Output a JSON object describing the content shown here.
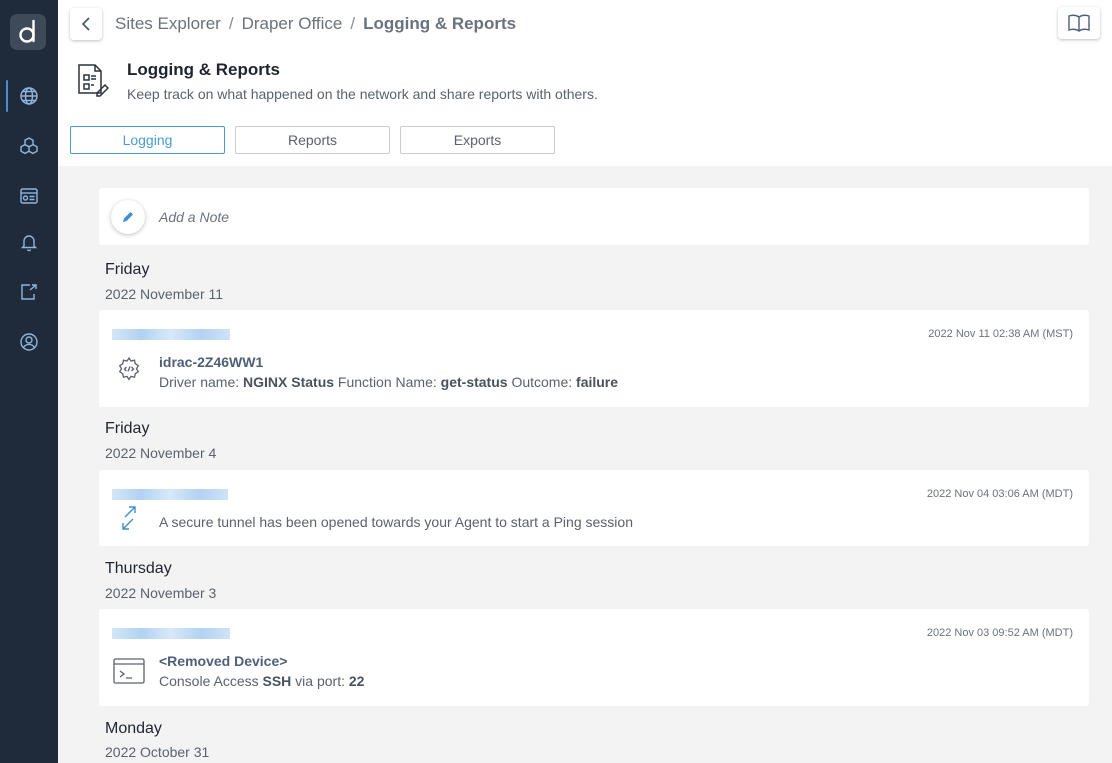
{
  "app": {
    "logo_letter": "d"
  },
  "sidebar": {
    "items": [
      {
        "icon": "globe-icon",
        "active": true
      },
      {
        "icon": "cubes-icon",
        "active": false
      },
      {
        "icon": "dashboard-icon",
        "active": false
      },
      {
        "icon": "bell-icon",
        "active": false
      },
      {
        "icon": "export-icon",
        "active": false
      },
      {
        "icon": "user-circle-icon",
        "active": false
      }
    ]
  },
  "breadcrumb": {
    "items": [
      "Sites Explorer",
      "Draper Office",
      "Logging & Reports"
    ],
    "separator": "/"
  },
  "page": {
    "title": "Logging & Reports",
    "subtitle": "Keep track on what happened on the network and share reports with others."
  },
  "tabs": [
    {
      "label": "Logging",
      "active": true
    },
    {
      "label": "Reports",
      "active": false
    },
    {
      "label": "Exports",
      "active": false
    }
  ],
  "note": {
    "label": "Add a Note"
  },
  "groups": [
    {
      "day": "Friday",
      "date": "2022 November 11",
      "entry": {
        "timestamp": "2022 Nov 11 02:38 AM (MST)",
        "icon": "gear-code-icon",
        "title": "idrac-2Z46WW1",
        "parts": [
          {
            "text": "Driver name: ",
            "bold": false
          },
          {
            "text": "NGINX Status",
            "bold": true
          },
          {
            "text": " Function Name: ",
            "bold": false
          },
          {
            "text": "get-status",
            "bold": true
          },
          {
            "text": " Outcome: ",
            "bold": false
          },
          {
            "text": "failure",
            "bold": true
          }
        ]
      }
    },
    {
      "day": "Friday",
      "date": "2022 November 4",
      "entry": {
        "timestamp": "2022 Nov 04 03:06 AM (MDT)",
        "icon": "tunnel-arrows-icon",
        "message": "A secure tunnel has been opened towards your Agent to start a Ping session"
      }
    },
    {
      "day": "Thursday",
      "date": "2022 November 3",
      "entry": {
        "timestamp": "2022 Nov 03 09:52 AM (MDT)",
        "icon": "terminal-icon",
        "title": "<Removed Device>",
        "parts": [
          {
            "text": "Console Access ",
            "bold": false
          },
          {
            "text": "SSH",
            "bold": true
          },
          {
            "text": " via port: ",
            "bold": false
          },
          {
            "text": "22",
            "bold": true
          }
        ]
      }
    },
    {
      "day": "Monday",
      "date": "2022 October 31"
    }
  ],
  "colors": {
    "sidebar_bg": "#1f2a3a",
    "accent": "#4a9ccf",
    "content_bg": "#f3f3f3"
  }
}
